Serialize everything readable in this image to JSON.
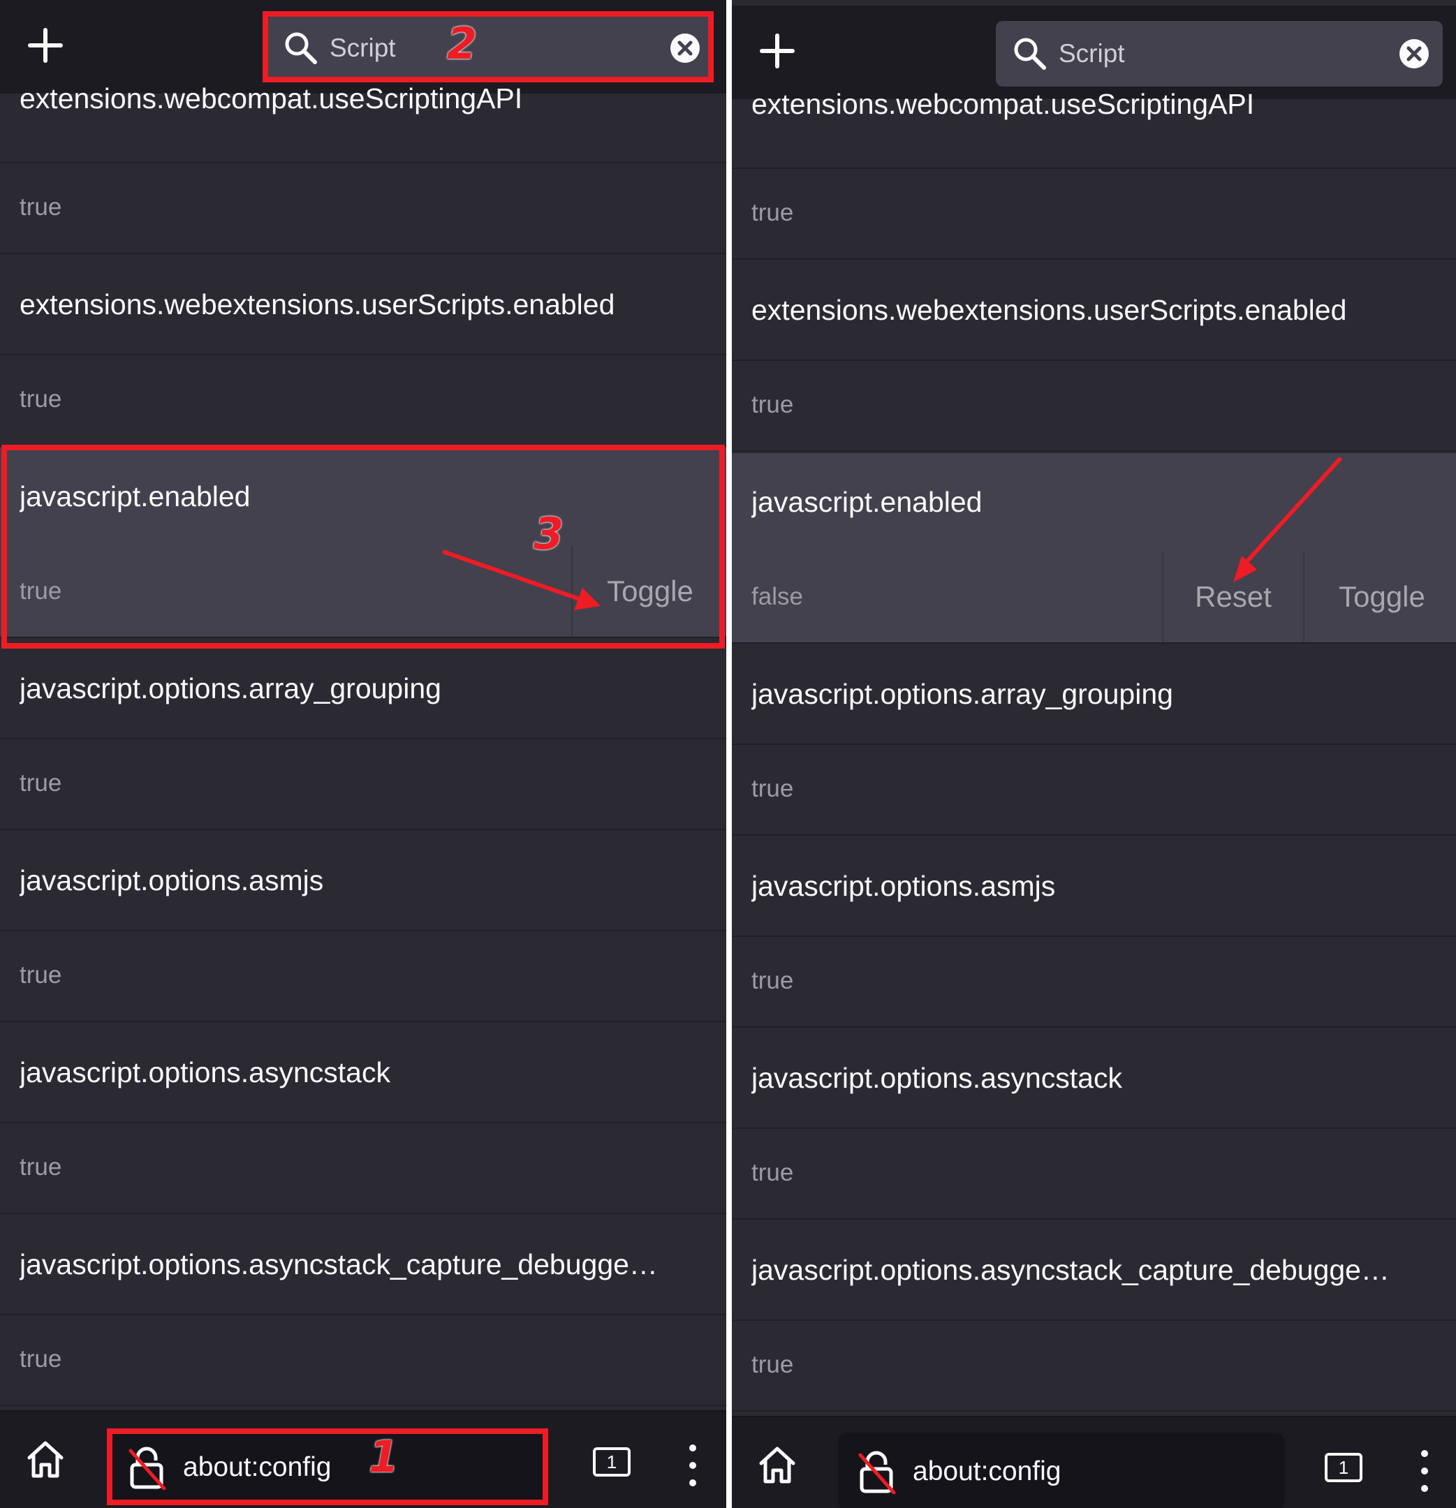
{
  "panels": [
    {
      "search": {
        "value": "Script"
      },
      "prefs": [
        {
          "name": "extensions.webcompat.useScriptingAPI",
          "value": "true"
        },
        {
          "name": "extensions.webextensions.userScripts.enabled",
          "value": "true"
        },
        {
          "name": "javascript.enabled",
          "value": "true",
          "toggle": "Toggle"
        },
        {
          "name": "javascript.options.array_grouping",
          "value": "true"
        },
        {
          "name": "javascript.options.asmjs",
          "value": "true"
        },
        {
          "name": "javascript.options.asyncstack",
          "value": "true"
        },
        {
          "name": "javascript.options.asyncstack_capture_debugge…",
          "value": "true"
        }
      ],
      "bottom": {
        "url": "about:config",
        "tab_count": "1"
      },
      "annotations": {
        "one": "1",
        "two": "2",
        "three": "3"
      }
    },
    {
      "search": {
        "value": "Script"
      },
      "prefs": [
        {
          "name": "extensions.webcompat.useScriptingAPI",
          "value": "true"
        },
        {
          "name": "extensions.webextensions.userScripts.enabled",
          "value": "true"
        },
        {
          "name": "javascript.enabled",
          "value": "false",
          "reset": "Reset",
          "toggle": "Toggle"
        },
        {
          "name": "javascript.options.array_grouping",
          "value": "true"
        },
        {
          "name": "javascript.options.asmjs",
          "value": "true"
        },
        {
          "name": "javascript.options.asyncstack",
          "value": "true"
        },
        {
          "name": "javascript.options.asyncstack_capture_debugge…",
          "value": "true"
        }
      ],
      "bottom": {
        "url": "about:config",
        "tab_count": "1"
      }
    }
  ],
  "colors": {
    "background": "#2b2a33",
    "toolbar": "#1c1b22",
    "selected_row": "#42414d",
    "annotation": "#ee1c25"
  },
  "icons": [
    "plus-icon",
    "search-icon",
    "clear-icon",
    "home-icon",
    "broken-lock-icon",
    "tabs-icon",
    "menu-icon"
  ]
}
